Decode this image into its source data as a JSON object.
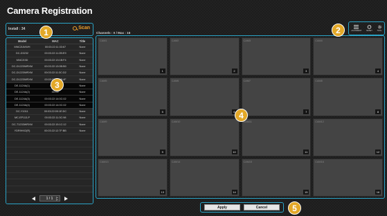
{
  "window": {
    "title": "Camera Registration"
  },
  "left_panel": {
    "install_label": "Install : 34",
    "scan_label": "Scan",
    "columns": [
      "Model",
      "MAC",
      "Title"
    ],
    "rows": [
      {
        "model": "MNC2IAVWH",
        "mac": "00:03:22:11:33:67",
        "title": "None",
        "selected": false
      },
      {
        "model": "DC-D3232",
        "mac": "00:03:22:11:2B:E9",
        "title": "None",
        "selected": false
      },
      {
        "model": "MNC2I3D",
        "mac": "00:03:22:13:1B:F4",
        "title": "None",
        "selected": false
      },
      {
        "model": "DC-D1223WRXM",
        "mac": "00:03:22:13:0B:B0",
        "title": "None",
        "selected": false
      },
      {
        "model": "DC-D1223WRXM",
        "mac": "00:03:22:11:3C:D2",
        "title": "None",
        "selected": false
      },
      {
        "model": "DC-D1223WRXM",
        "mac": "00:03:22:13:0B:4F",
        "title": "None",
        "selected": false
      },
      {
        "model": "DE-1124A(1)",
        "mac": "00:03:22:",
        "title": "None",
        "selected": true
      },
      {
        "model": "DE-1124A(2)",
        "mac": "00:03:",
        "title": "None",
        "selected": true
      },
      {
        "model": "DE-1124A(3)",
        "mac": "00:03:22:14:0C:02",
        "title": "None",
        "selected": true
      },
      {
        "model": "DE-1124A(4)",
        "mac": "00:03:22:14:0C:02",
        "title": "None",
        "selected": true
      },
      {
        "model": "DC-Y1011",
        "mac": "00:03:22:09:1E:DC",
        "title": "None",
        "selected": false
      },
      {
        "model": "MC-EP113-P",
        "mac": "00:03:22:11:3C:98",
        "title": "None",
        "selected": false
      },
      {
        "model": "DC-T1233WRXM",
        "mac": "00:03:22:15:1C:12",
        "title": "None",
        "selected": false
      },
      {
        "model": "YDR9HX2(R)",
        "mac": "00:03:22:12:7F:BB",
        "title": "None",
        "selected": false
      },
      {
        "model": "",
        "mac": "",
        "title": "",
        "selected": false
      },
      {
        "model": "",
        "mac": "",
        "title": "",
        "selected": false
      },
      {
        "model": "",
        "mac": "",
        "title": "",
        "selected": false
      },
      {
        "model": "",
        "mac": "",
        "title": "",
        "selected": false
      },
      {
        "model": "",
        "mac": "",
        "title": "",
        "selected": false
      },
      {
        "model": "",
        "mac": "",
        "title": "",
        "selected": false
      },
      {
        "model": "",
        "mac": "",
        "title": "",
        "selected": false
      },
      {
        "model": "",
        "mac": "",
        "title": "",
        "selected": false
      },
      {
        "model": "",
        "mac": "",
        "title": "",
        "selected": false
      },
      {
        "model": "",
        "mac": "",
        "title": "",
        "selected": false
      }
    ],
    "pager": {
      "text": "1 / 1"
    }
  },
  "channels": {
    "label": "Channels : 0 / Max : 16",
    "cells": [
      {
        "name": "CAM1",
        "num": "1"
      },
      {
        "name": "CAM2",
        "num": "2"
      },
      {
        "name": "CAM3",
        "num": "3"
      },
      {
        "name": "CAM4",
        "num": "4"
      },
      {
        "name": "CAM5",
        "num": "5"
      },
      {
        "name": "CAM6",
        "num": "6"
      },
      {
        "name": "CAM7",
        "num": "7"
      },
      {
        "name": "CAM8",
        "num": "8"
      },
      {
        "name": "CAM9",
        "num": "9"
      },
      {
        "name": "CAM10",
        "num": "10"
      },
      {
        "name": "CAM11",
        "num": "11"
      },
      {
        "name": "CAM12",
        "num": "12"
      },
      {
        "name": "CAM13",
        "num": "13"
      },
      {
        "name": "CAM14",
        "num": "14"
      },
      {
        "name": "CAM15",
        "num": "15"
      },
      {
        "name": "CAM16",
        "num": "16"
      }
    ]
  },
  "toolbar": {
    "items": [
      {
        "label": "ALIGNMENT",
        "icon": "list-icon"
      },
      {
        "label": "RESET",
        "icon": "reset-icon"
      },
      {
        "label": "TOOL",
        "icon": "gear-icon"
      }
    ]
  },
  "buttons": {
    "apply": "Apply",
    "cancel": "Cancel"
  },
  "callouts": [
    "1",
    "2",
    "3",
    "4",
    "5"
  ],
  "colors": {
    "accent": "#2ba5c8",
    "callout": "#e3a828",
    "scan": "#f0a02a"
  }
}
